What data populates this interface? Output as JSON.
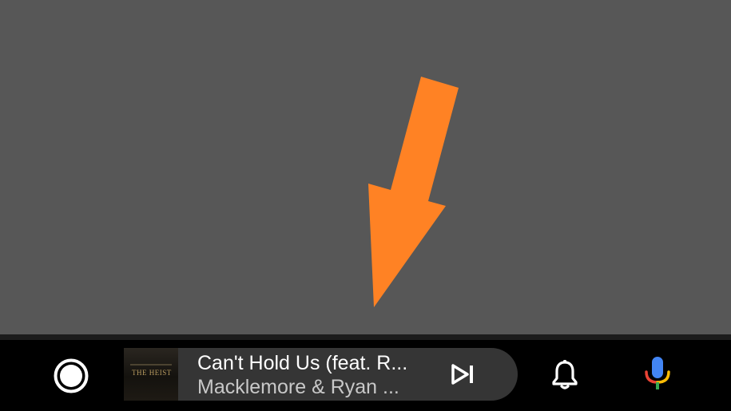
{
  "screen": {
    "background_color": "#575757",
    "arrow_color": "#FF8224"
  },
  "nav_bar": {
    "home_icon": "home-circle-icon",
    "media": {
      "album_art_text": "THE HEIST",
      "track_title": "Can't Hold Us (feat. R...",
      "track_artist": "Macklemore & Ryan ...",
      "skip_icon": "skip-next-icon"
    },
    "notifications_icon": "bell-icon",
    "voice_icon": "microphone-icon"
  }
}
